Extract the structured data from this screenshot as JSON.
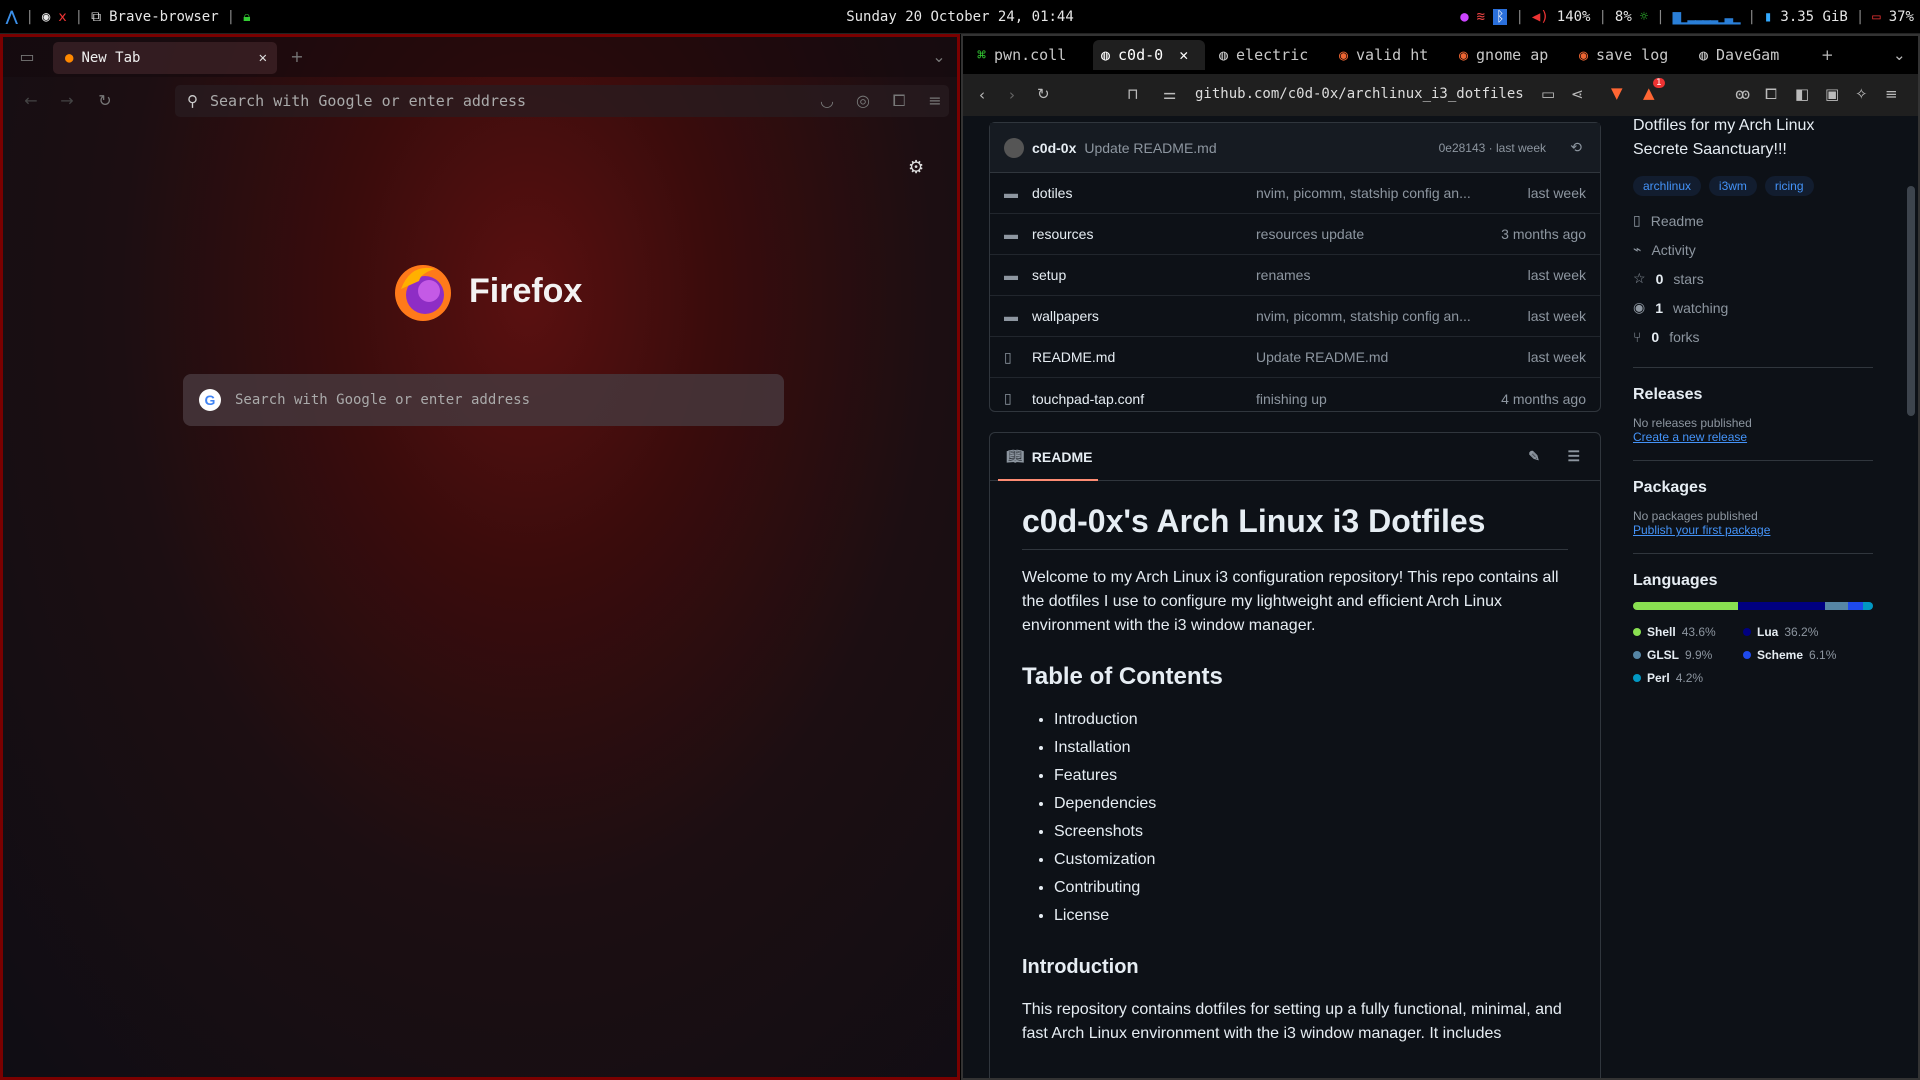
{
  "topbar": {
    "workspace_icon": "arch-icon",
    "app": "Brave-browser",
    "datetime": "Sunday 20 October 24, 01:44",
    "volume": "140%",
    "brightness": "8%",
    "memory": "3.35 GiB",
    "battery": "37%"
  },
  "firefox": {
    "tab_title": "New Tab",
    "url_placeholder": "Search with Google or enter address",
    "brand": "Firefox",
    "search_placeholder": "Search with Google or enter address"
  },
  "brave": {
    "tabs": [
      "pwn.coll",
      "c0d-0",
      "electric",
      "valid ht",
      "gnome ap",
      "save log",
      "DaveGam"
    ],
    "url": "github.com/c0d-0x/archlinux_i3_dotfiles",
    "badge": "1"
  },
  "repo": {
    "commit_user": "c0d-0x",
    "commit_msg": "Update README.md",
    "commit_hash": "0e28143 · last week",
    "files": [
      {
        "name": "dotiles",
        "type": "folder",
        "msg": "nvim, picomm, statship config an...",
        "time": "last week"
      },
      {
        "name": "resources",
        "type": "folder",
        "msg": "resources update",
        "time": "3 months ago"
      },
      {
        "name": "setup",
        "type": "folder",
        "msg": "renames",
        "time": "last week"
      },
      {
        "name": "wallpapers",
        "type": "folder",
        "msg": "nvim, picomm, statship config an...",
        "time": "last week"
      },
      {
        "name": "README.md",
        "type": "file",
        "msg": "Update README.md",
        "time": "last week"
      },
      {
        "name": "touchpad-tap.conf",
        "type": "file",
        "msg": "finishing up",
        "time": "4 months ago"
      }
    ],
    "readme_label": "README",
    "readme": {
      "h1": "c0d-0x's Arch Linux i3 Dotfiles",
      "intro": "Welcome to my Arch Linux i3 configuration repository! This repo contains all the dotfiles I use to configure my lightweight and efficient Arch Linux environment with the i3 window manager.",
      "toc_title": "Table of Contents",
      "toc": [
        "Introduction",
        "Installation",
        "Features",
        "Dependencies",
        "Screenshots",
        "Customization",
        "Contributing",
        "License"
      ],
      "h2_intro": "Introduction",
      "intro_text": "This repository contains dotfiles for setting up a fully functional, minimal, and fast Arch Linux environment with the i3 window manager. It includes"
    },
    "about": {
      "desc": "Dotfiles for my Arch Linux Secrete Saanctuary!!!",
      "tags": [
        "archlinux",
        "i3wm",
        "ricing"
      ],
      "readme": "Readme",
      "activity": "Activity",
      "stars_n": "0",
      "stars": "stars",
      "watching_n": "1",
      "watching": "watching",
      "forks_n": "0",
      "forks": "forks"
    },
    "releases": {
      "title": "Releases",
      "none": "No releases published",
      "link": "Create a new release"
    },
    "packages": {
      "title": "Packages",
      "none": "No packages published",
      "link": "Publish your first package"
    },
    "languages": {
      "title": "Languages",
      "items": [
        {
          "name": "Shell",
          "pct": "43.6%",
          "value": 43.6,
          "color": "#89e051"
        },
        {
          "name": "Lua",
          "pct": "36.2%",
          "value": 36.2,
          "color": "#000080"
        },
        {
          "name": "GLSL",
          "pct": "9.9%",
          "value": 9.9,
          "color": "#5686a5"
        },
        {
          "name": "Scheme",
          "pct": "6.1%",
          "value": 6.1,
          "color": "#1e4aec"
        },
        {
          "name": "Perl",
          "pct": "4.2%",
          "value": 4.2,
          "color": "#0298c3"
        }
      ]
    }
  }
}
